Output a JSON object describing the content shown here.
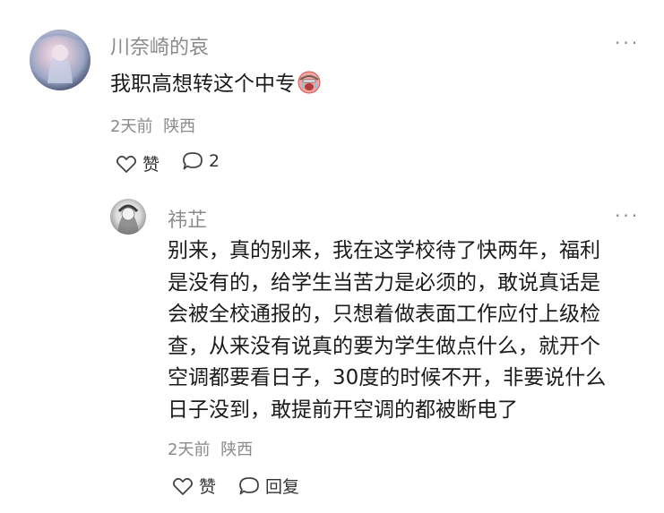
{
  "comment": {
    "username": "川奈崎的哀",
    "text": "我职高想转这个中专",
    "emoji": "crying-face-emoji",
    "time": "2天前",
    "location": "陕西",
    "like_label": "赞",
    "reply_count": "2",
    "more_label": "···"
  },
  "reply": {
    "username": "祎芷",
    "text_lines": [
      "别来，真的别来，我在这学校待了快两年，福利",
      "是没有的，给学生当苦力是必须的，敢说真话是",
      "会被全校通报的，只想着做表面工作应付上级检",
      "查，从来没有说真的要为学生做点什么，就开个",
      "空调都要看日子，30度的时候不开，非要说什么",
      "日子没到，敢提前开空调的都被断电了"
    ],
    "time": "2天前",
    "location": "陕西",
    "like_label": "赞",
    "reply_label": "回复",
    "more_label": "···"
  },
  "icons": [
    "heart-outline-icon",
    "comment-bubble-icon",
    "more-dots-icon"
  ]
}
